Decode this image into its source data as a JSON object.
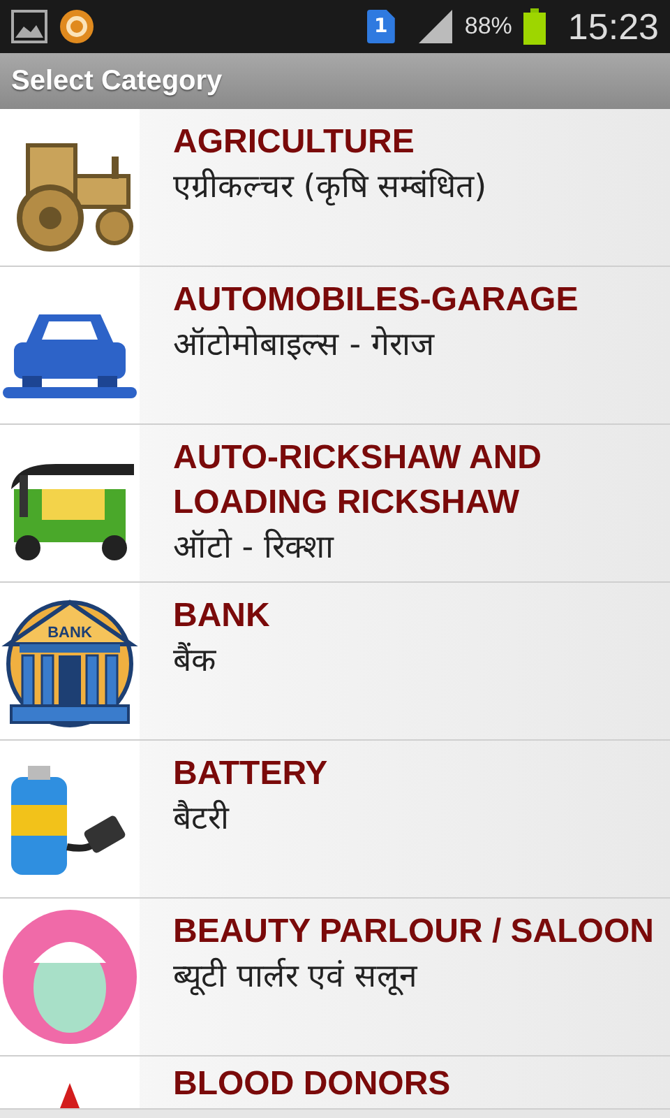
{
  "status_bar": {
    "sim_label": "1",
    "battery_percent": "88%",
    "time": "15:23"
  },
  "title_bar": {
    "title": "Select Category"
  },
  "categories": [
    {
      "title": "AGRICULTURE",
      "subtitle": "एग्रीकल्चर (कृषि सम्बंधित)"
    },
    {
      "title": "AUTOMOBILES-GARAGE",
      "subtitle": "ऑटोमोबाइल्स - गेराज"
    },
    {
      "title": "AUTO-RICKSHAW AND LOADING RICKSHAW",
      "subtitle": "ऑटो - रिक्शा"
    },
    {
      "title": "BANK",
      "subtitle": "बैंक",
      "icon_text": "BANK"
    },
    {
      "title": "BATTERY",
      "subtitle": "बैटरी"
    },
    {
      "title": "BEAUTY PARLOUR / SALOON",
      "subtitle": "ब्यूटी पार्लर एवं सलून"
    },
    {
      "title": "BLOOD DONORS"
    }
  ]
}
